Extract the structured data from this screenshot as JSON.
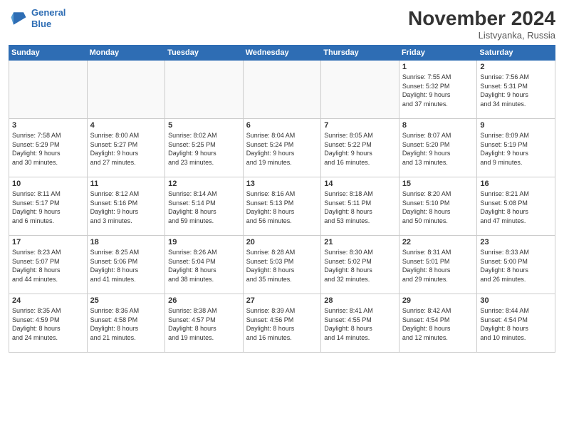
{
  "logo": {
    "line1": "General",
    "line2": "Blue"
  },
  "title": "November 2024",
  "location": "Listvyanka, Russia",
  "days_header": [
    "Sunday",
    "Monday",
    "Tuesday",
    "Wednesday",
    "Thursday",
    "Friday",
    "Saturday"
  ],
  "weeks": [
    [
      {
        "day": "",
        "info": ""
      },
      {
        "day": "",
        "info": ""
      },
      {
        "day": "",
        "info": ""
      },
      {
        "day": "",
        "info": ""
      },
      {
        "day": "",
        "info": ""
      },
      {
        "day": "1",
        "info": "Sunrise: 7:55 AM\nSunset: 5:32 PM\nDaylight: 9 hours\nand 37 minutes."
      },
      {
        "day": "2",
        "info": "Sunrise: 7:56 AM\nSunset: 5:31 PM\nDaylight: 9 hours\nand 34 minutes."
      }
    ],
    [
      {
        "day": "3",
        "info": "Sunrise: 7:58 AM\nSunset: 5:29 PM\nDaylight: 9 hours\nand 30 minutes."
      },
      {
        "day": "4",
        "info": "Sunrise: 8:00 AM\nSunset: 5:27 PM\nDaylight: 9 hours\nand 27 minutes."
      },
      {
        "day": "5",
        "info": "Sunrise: 8:02 AM\nSunset: 5:25 PM\nDaylight: 9 hours\nand 23 minutes."
      },
      {
        "day": "6",
        "info": "Sunrise: 8:04 AM\nSunset: 5:24 PM\nDaylight: 9 hours\nand 19 minutes."
      },
      {
        "day": "7",
        "info": "Sunrise: 8:05 AM\nSunset: 5:22 PM\nDaylight: 9 hours\nand 16 minutes."
      },
      {
        "day": "8",
        "info": "Sunrise: 8:07 AM\nSunset: 5:20 PM\nDaylight: 9 hours\nand 13 minutes."
      },
      {
        "day": "9",
        "info": "Sunrise: 8:09 AM\nSunset: 5:19 PM\nDaylight: 9 hours\nand 9 minutes."
      }
    ],
    [
      {
        "day": "10",
        "info": "Sunrise: 8:11 AM\nSunset: 5:17 PM\nDaylight: 9 hours\nand 6 minutes."
      },
      {
        "day": "11",
        "info": "Sunrise: 8:12 AM\nSunset: 5:16 PM\nDaylight: 9 hours\nand 3 minutes."
      },
      {
        "day": "12",
        "info": "Sunrise: 8:14 AM\nSunset: 5:14 PM\nDaylight: 8 hours\nand 59 minutes."
      },
      {
        "day": "13",
        "info": "Sunrise: 8:16 AM\nSunset: 5:13 PM\nDaylight: 8 hours\nand 56 minutes."
      },
      {
        "day": "14",
        "info": "Sunrise: 8:18 AM\nSunset: 5:11 PM\nDaylight: 8 hours\nand 53 minutes."
      },
      {
        "day": "15",
        "info": "Sunrise: 8:20 AM\nSunset: 5:10 PM\nDaylight: 8 hours\nand 50 minutes."
      },
      {
        "day": "16",
        "info": "Sunrise: 8:21 AM\nSunset: 5:08 PM\nDaylight: 8 hours\nand 47 minutes."
      }
    ],
    [
      {
        "day": "17",
        "info": "Sunrise: 8:23 AM\nSunset: 5:07 PM\nDaylight: 8 hours\nand 44 minutes."
      },
      {
        "day": "18",
        "info": "Sunrise: 8:25 AM\nSunset: 5:06 PM\nDaylight: 8 hours\nand 41 minutes."
      },
      {
        "day": "19",
        "info": "Sunrise: 8:26 AM\nSunset: 5:04 PM\nDaylight: 8 hours\nand 38 minutes."
      },
      {
        "day": "20",
        "info": "Sunrise: 8:28 AM\nSunset: 5:03 PM\nDaylight: 8 hours\nand 35 minutes."
      },
      {
        "day": "21",
        "info": "Sunrise: 8:30 AM\nSunset: 5:02 PM\nDaylight: 8 hours\nand 32 minutes."
      },
      {
        "day": "22",
        "info": "Sunrise: 8:31 AM\nSunset: 5:01 PM\nDaylight: 8 hours\nand 29 minutes."
      },
      {
        "day": "23",
        "info": "Sunrise: 8:33 AM\nSunset: 5:00 PM\nDaylight: 8 hours\nand 26 minutes."
      }
    ],
    [
      {
        "day": "24",
        "info": "Sunrise: 8:35 AM\nSunset: 4:59 PM\nDaylight: 8 hours\nand 24 minutes."
      },
      {
        "day": "25",
        "info": "Sunrise: 8:36 AM\nSunset: 4:58 PM\nDaylight: 8 hours\nand 21 minutes."
      },
      {
        "day": "26",
        "info": "Sunrise: 8:38 AM\nSunset: 4:57 PM\nDaylight: 8 hours\nand 19 minutes."
      },
      {
        "day": "27",
        "info": "Sunrise: 8:39 AM\nSunset: 4:56 PM\nDaylight: 8 hours\nand 16 minutes."
      },
      {
        "day": "28",
        "info": "Sunrise: 8:41 AM\nSunset: 4:55 PM\nDaylight: 8 hours\nand 14 minutes."
      },
      {
        "day": "29",
        "info": "Sunrise: 8:42 AM\nSunset: 4:54 PM\nDaylight: 8 hours\nand 12 minutes."
      },
      {
        "day": "30",
        "info": "Sunrise: 8:44 AM\nSunset: 4:54 PM\nDaylight: 8 hours\nand 10 minutes."
      }
    ]
  ]
}
